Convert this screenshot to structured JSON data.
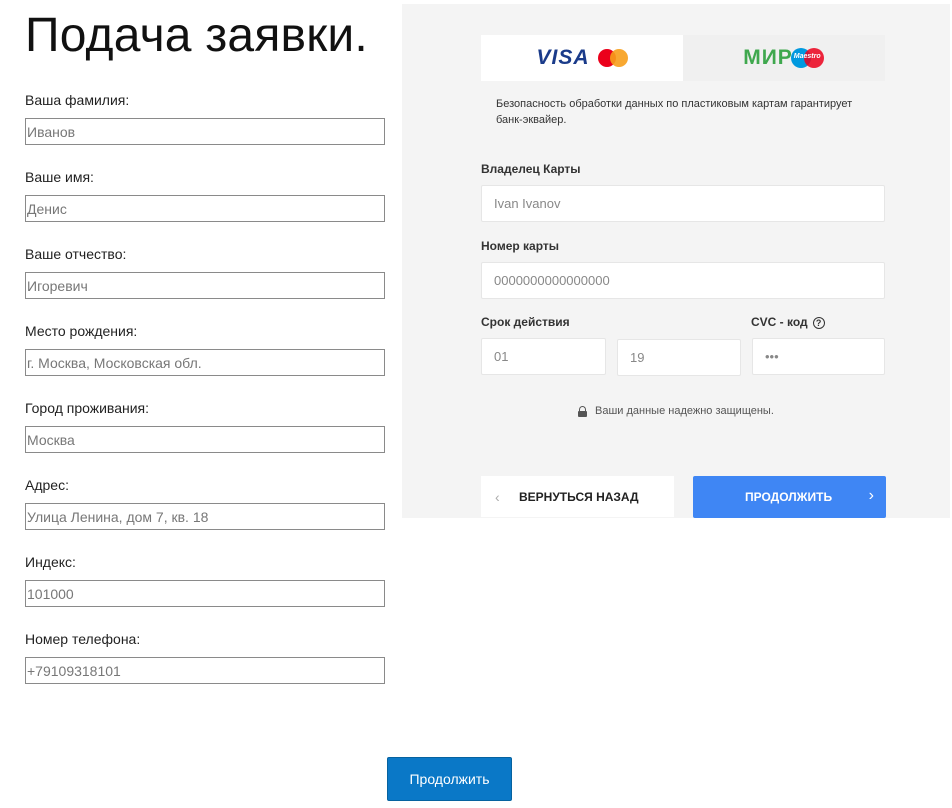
{
  "page": {
    "title": "Подача заявки."
  },
  "form": {
    "fields": [
      {
        "label": "Ваша фамилия:",
        "placeholder": "Иванов",
        "value": ""
      },
      {
        "label": "Ваше имя:",
        "placeholder": "Денис",
        "value": ""
      },
      {
        "label": "Ваше отчество:",
        "placeholder": "Игоревич",
        "value": ""
      },
      {
        "label": "Место рождения:",
        "placeholder": "г. Москва, Московская обл.",
        "value": ""
      },
      {
        "label": "Город проживания:",
        "placeholder": "Москва",
        "value": ""
      },
      {
        "label": "Адрес:",
        "placeholder": "Улица Ленина, дом 7, кв. 18",
        "value": ""
      },
      {
        "label": "Индекс:",
        "placeholder": "101000",
        "value": ""
      },
      {
        "label": "Номер телефона:",
        "placeholder": "+79109318101",
        "value": ""
      }
    ],
    "submit_label": "Продолжить"
  },
  "payment": {
    "tabs": [
      {
        "name": "VISA",
        "secondary": "mastercard-logo",
        "active": true
      },
      {
        "name": "МИР",
        "secondary": "Maestro",
        "active": false
      }
    ],
    "security_note": "Безопасность обработки данных по пластиковым картам гарантирует банк-эквайер.",
    "holder_label": "Владелец Карты",
    "holder_placeholder": "Ivan Ivanov",
    "number_label": "Номер карты",
    "number_placeholder": "0000000000000000",
    "expiry_label": "Срок действия",
    "month_placeholder": "01",
    "year_placeholder": "19",
    "cvc_label": "CVC - код",
    "cvc_help": "?",
    "cvc_placeholder": "•••",
    "secure_text": "Ваши данные надежно защищены.",
    "back_label": "ВЕРНУТЬСЯ НАЗАД",
    "next_label": "ПРОДОЛЖИТЬ",
    "colors": {
      "accent": "#3f86f4",
      "submit": "#0a78c7",
      "panel": "#f4f4f4"
    }
  }
}
